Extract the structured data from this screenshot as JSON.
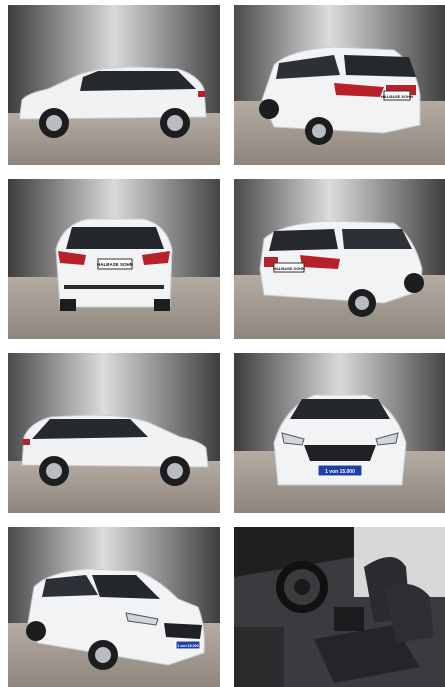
{
  "gallery": {
    "photos": [
      {
        "view": "side-left",
        "plate": ""
      },
      {
        "view": "rear-three-quarter-left",
        "plate": "HALBASE SOHN"
      },
      {
        "view": "rear",
        "plate": "HALBASE SOHN"
      },
      {
        "view": "rear-three-quarter-right",
        "plate": "HALBASE SOHN"
      },
      {
        "view": "side-right",
        "plate": ""
      },
      {
        "view": "front",
        "plate": "1 von 15.000"
      },
      {
        "view": "front-three-quarter",
        "plate": "1 von 15.000"
      },
      {
        "view": "interior",
        "plate": ""
      }
    ]
  },
  "colors": {
    "car_body": "#f2f3f5",
    "floor": "#a89f96",
    "plate_blue": "#1f3fa8",
    "taillight": "#b8202a"
  }
}
